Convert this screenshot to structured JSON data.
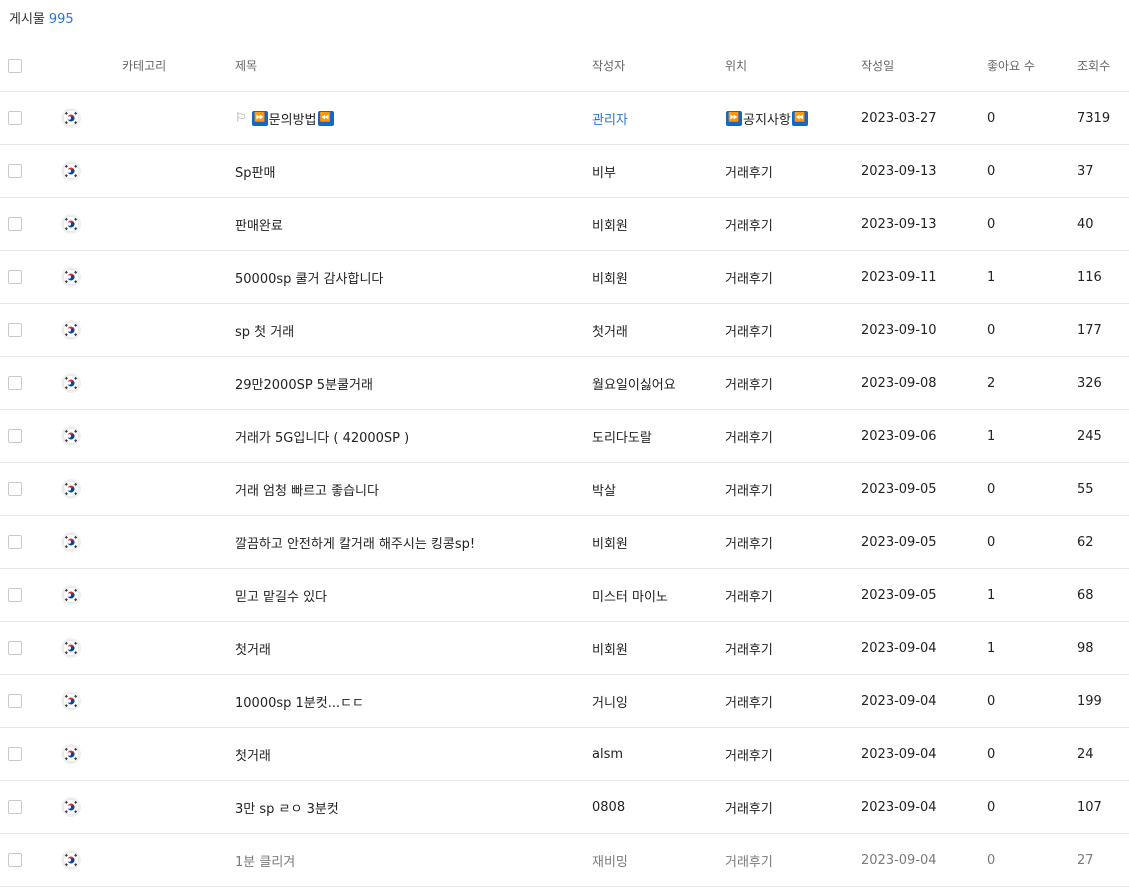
{
  "board": {
    "count_label": "게시물",
    "count_value": "995"
  },
  "columns": {
    "category": "카테고리",
    "title": "제목",
    "author": "작성자",
    "location": "위치",
    "date": "작성일",
    "likes": "좋아요 수",
    "views": "조회수"
  },
  "icons": {
    "notice_flag": "flag-outline-icon",
    "ff_icon": "fast-forward-icon",
    "rw_icon": "rewind-icon",
    "country": "korea-flag-icon"
  },
  "colors": {
    "link": "#2a74d8",
    "emoji_blue": "#1467c8",
    "border": "#e6e6e6"
  },
  "notice": {
    "title": "문의방법",
    "author": "관리자",
    "location": "공지사항",
    "date": "2023-03-27",
    "likes": "0",
    "views": "7319"
  },
  "rows": [
    {
      "title": "Sp판매",
      "author": "비부",
      "location": "거래후기",
      "date": "2023-09-13",
      "likes": "0",
      "views": "37"
    },
    {
      "title": "판매완료",
      "author": "비회원",
      "location": "거래후기",
      "date": "2023-09-13",
      "likes": "0",
      "views": "40"
    },
    {
      "title": "50000sp 쿨거 감사합니다",
      "author": "비회원",
      "location": "거래후기",
      "date": "2023-09-11",
      "likes": "1",
      "views": "116"
    },
    {
      "title": "sp 첫 거래",
      "author": "첫거래",
      "location": "거래후기",
      "date": "2023-09-10",
      "likes": "0",
      "views": "177"
    },
    {
      "title": "29만2000SP 5분쿨거래",
      "author": "월요일이싫어요",
      "location": "거래후기",
      "date": "2023-09-08",
      "likes": "2",
      "views": "326"
    },
    {
      "title": "거래가 5G입니다 ( 42000SP )",
      "author": "도리다도랄",
      "location": "거래후기",
      "date": "2023-09-06",
      "likes": "1",
      "views": "245"
    },
    {
      "title": "거래 엄청 빠르고 좋습니다",
      "author": "박살",
      "location": "거래후기",
      "date": "2023-09-05",
      "likes": "0",
      "views": "55"
    },
    {
      "title": "깔끔하고 안전하게 칼거래 해주시는 킹콩sp!",
      "author": "비회원",
      "location": "거래후기",
      "date": "2023-09-05",
      "likes": "0",
      "views": "62"
    },
    {
      "title": "믿고 맡길수 있다",
      "author": "미스터 마이노",
      "location": "거래후기",
      "date": "2023-09-05",
      "likes": "1",
      "views": "68"
    },
    {
      "title": "첫거래",
      "author": "비회원",
      "location": "거래후기",
      "date": "2023-09-04",
      "likes": "1",
      "views": "98"
    },
    {
      "title": "10000sp 1분컷...ㄷㄷ",
      "author": "거니잉",
      "location": "거래후기",
      "date": "2023-09-04",
      "likes": "0",
      "views": "199"
    },
    {
      "title": "첫거래",
      "author": "alsm",
      "location": "거래후기",
      "date": "2023-09-04",
      "likes": "0",
      "views": "24"
    },
    {
      "title": "3만 sp ㄹㅇ 3분컷",
      "author": "0808",
      "location": "거래후기",
      "date": "2023-09-04",
      "likes": "0",
      "views": "107"
    },
    {
      "title": "1분 클리겨",
      "author": "재비밍",
      "location": "거래후기",
      "date": "2023-09-04",
      "likes": "0",
      "views": "27"
    }
  ]
}
